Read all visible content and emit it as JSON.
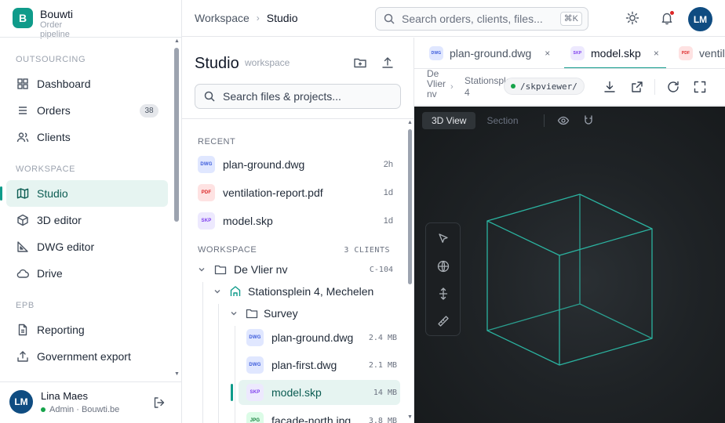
{
  "brand": {
    "logo_letter": "B",
    "name": "Bouwti",
    "tagline": "Order pipeline"
  },
  "sidebar": {
    "sections": [
      {
        "title": "OUTSOURCING",
        "items": [
          {
            "label": "Dashboard",
            "icon": "grid-icon"
          },
          {
            "label": "Orders",
            "icon": "list-icon",
            "badge": "38"
          },
          {
            "label": "Clients",
            "icon": "users-icon"
          }
        ]
      },
      {
        "title": "WORKSPACE",
        "items": [
          {
            "label": "Studio",
            "icon": "map-icon",
            "active": true
          },
          {
            "label": "3D editor",
            "icon": "cube-icon"
          },
          {
            "label": "DWG editor",
            "icon": "ruler-triangle-icon"
          },
          {
            "label": "Drive",
            "icon": "cloud-icon"
          }
        ]
      },
      {
        "title": "EPB",
        "items": [
          {
            "label": "Reporting",
            "icon": "report-icon"
          },
          {
            "label": "Government export",
            "icon": "upload-icon"
          }
        ]
      }
    ],
    "user": {
      "initials": "LM",
      "name": "Lina Maes",
      "role": "Admin · Bouwti.be"
    }
  },
  "topbar": {
    "breadcrumb": [
      "Workspace",
      "Studio"
    ],
    "search_placeholder": "Search orders, clients, files...",
    "shortcut": "⌘K",
    "avatar": "LM"
  },
  "panel": {
    "title": "Studio",
    "subtitle": "workspace",
    "search_placeholder": "Search files & projects...",
    "recent_title": "RECENT",
    "recent": [
      {
        "type": "DWG",
        "name": "plan-ground.dwg",
        "age": "2h"
      },
      {
        "type": "PDF",
        "name": "ventilation-report.pdf",
        "age": "1d"
      },
      {
        "type": "SKP",
        "name": "model.skp",
        "age": "1d"
      }
    ],
    "workspace_title": "WORKSPACE",
    "workspace_count": "3 CLIENTS",
    "client": {
      "name": "De Vlier nv",
      "code": "C-104"
    },
    "project": {
      "name": "Stationsplein 4, Mechelen"
    },
    "folder": {
      "name": "Survey"
    },
    "files": [
      {
        "type": "DWG",
        "name": "plan-ground.dwg",
        "size": "2.4 MB"
      },
      {
        "type": "DWG",
        "name": "plan-first.dwg",
        "size": "2.1 MB"
      },
      {
        "type": "SKP",
        "name": "model.skp",
        "size": "14 MB",
        "selected": true
      },
      {
        "type": "JPG",
        "name": "facade-north.jpg",
        "size": "3.8 MB"
      }
    ]
  },
  "viewer": {
    "tabs": [
      {
        "type": "DWG",
        "name": "plan-ground.dwg",
        "close": "×"
      },
      {
        "type": "SKP",
        "name": "model.skp",
        "close": "×",
        "active": true
      },
      {
        "type": "PDF",
        "name": "ventilation-report.pdf"
      }
    ],
    "crumb_client": "De Vlier nv",
    "crumb_project_lines": [
      "Stationsplein",
      "4"
    ],
    "path": "/skpviewer/",
    "view_modes": [
      "3D View",
      "Section"
    ],
    "colors": {
      "cube_stroke": "#2bb3a0",
      "accent": "#0f9b8a"
    }
  }
}
